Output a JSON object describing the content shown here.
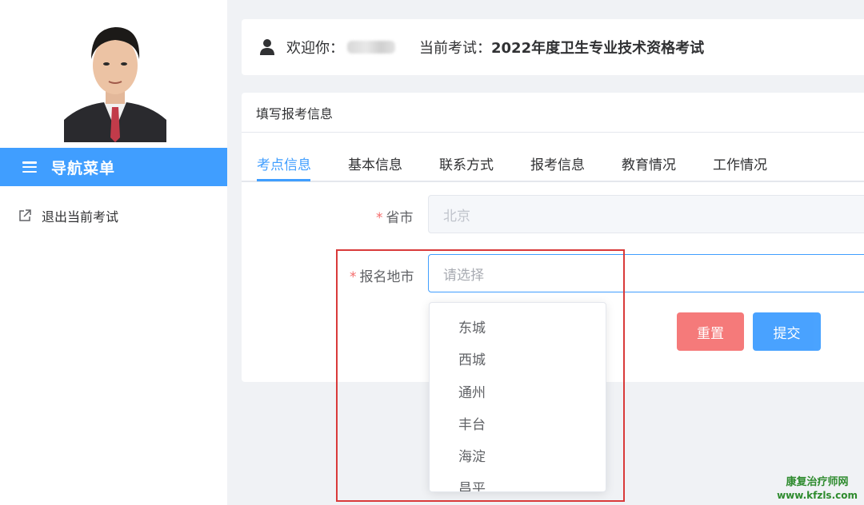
{
  "sidebar": {
    "nav_title": "导航菜单",
    "items": [
      {
        "label": "退出当前考试",
        "icon": "external-link-icon"
      }
    ]
  },
  "header": {
    "welcome_label": "欢迎你：",
    "exam_label": "当前考试：",
    "exam_name": "2022年度卫生专业技术资格考试"
  },
  "form": {
    "card_title": "填写报考信息",
    "tabs": [
      {
        "label": "考点信息",
        "active": true
      },
      {
        "label": "基本信息",
        "active": false
      },
      {
        "label": "联系方式",
        "active": false
      },
      {
        "label": "报考信息",
        "active": false
      },
      {
        "label": "教育情况",
        "active": false
      },
      {
        "label": "工作情况",
        "active": false
      }
    ],
    "fields": {
      "province": {
        "label": "省市",
        "value": "北京",
        "required_mark": "*"
      },
      "city": {
        "label": "报名地市",
        "placeholder": "请选择",
        "required_mark": "*"
      }
    },
    "buttons": {
      "reset": "重置",
      "submit": "提交"
    },
    "dropdown_options": [
      "东城",
      "西城",
      "通州",
      "丰台",
      "海淀",
      "昌平"
    ]
  },
  "watermark": {
    "line1": "康复治疗师网",
    "line2": "www.kfzls.com"
  },
  "colors": {
    "primary": "#409eff",
    "danger": "#f56c6c",
    "annotation": "#d93a3a",
    "watermark": "#2e8b2e"
  }
}
